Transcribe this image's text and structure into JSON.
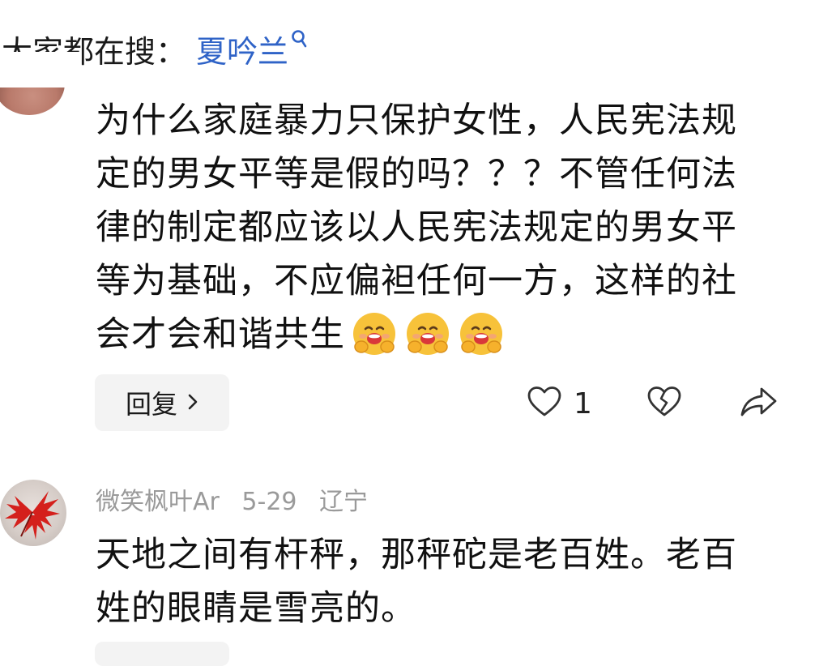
{
  "search": {
    "prefix": "大家都在搜：",
    "term": "夏吟兰"
  },
  "comments": [
    {
      "text": "为什么家庭暴力只保护女性，人民宪法规定的男女平等是假的吗？？？不管任何法律的制定都应该以人民宪法规定的男女平等为基础，不应偏袒任何一方，这样的社会才会和谐共生",
      "emoji_count": 3,
      "reply_label": "回复",
      "likes": "1"
    },
    {
      "author": "微笑枫叶Ar",
      "date": "5-29",
      "location": "辽宁",
      "text": "天地之间有杆秤，那秤砣是老百姓。老百姓的眼睛是雪亮的。"
    }
  ],
  "colors": {
    "search_term": "#2f63c7",
    "meta_gray": "#9a9a9a",
    "reply_bg": "#f3f3f3"
  },
  "icons": {
    "search_term": "search-icon",
    "emoji": "hugging-face-emoji",
    "like": "heart-outline-icon",
    "dislike": "broken-heart-icon",
    "share": "share-arrow-icon"
  }
}
